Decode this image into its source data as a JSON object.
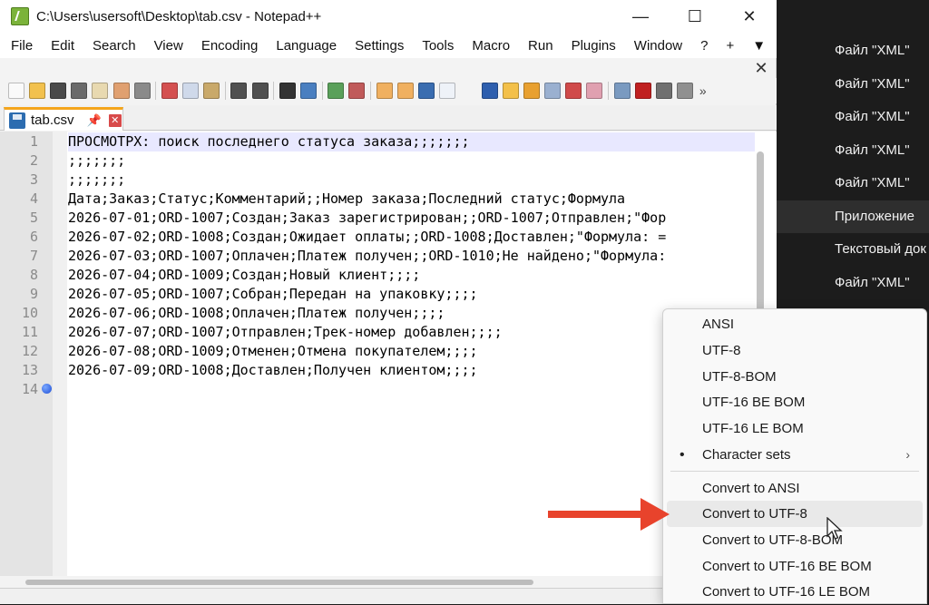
{
  "window": {
    "title": "C:\\Users\\usersoft\\Desktop\\tab.csv - Notepad++",
    "controls": [
      "—",
      "☐",
      "✕"
    ]
  },
  "menu": [
    "File",
    "Edit",
    "Search",
    "View",
    "Encoding",
    "Language",
    "Settings",
    "Tools",
    "Macro",
    "Run",
    "Plugins",
    "Window",
    "?",
    "+",
    "▼"
  ],
  "menu_close": "✕",
  "toolbar_more": "»",
  "tab": {
    "label": "tab.csv",
    "pin": "📌",
    "close": "✕"
  },
  "editor": {
    "lines": [
      "ПРОСМОТРХ: поиск последнего статуса заказа;;;;;;;",
      ";;;;;;;",
      ";;;;;;;",
      "Дата;Заказ;Статус;Комментарий;;Номер заказа;Последний статус;Формула",
      "2026-07-01;ORD-1007;Создан;Заказ зарегистрирован;;ORD-1007;Отправлен;\"Фор",
      "2026-07-02;ORD-1008;Создан;Ожидает оплаты;;ORD-1008;Доставлен;\"Формула: =",
      "2026-07-03;ORD-1007;Оплачен;Платеж получен;;ORD-1010;Не найдено;\"Формула:",
      "2026-07-04;ORD-1009;Создан;Новый клиент;;;;",
      "2026-07-05;ORD-1007;Собран;Передан на упаковку;;;;",
      "2026-07-06;ORD-1008;Оплачен;Платеж получен;;;;",
      "2026-07-07;ORD-1007;Отправлен;Трек-номер добавлен;;;;",
      "2026-07-08;ORD-1009;Отменен;Отмена покупателем;;;;",
      "2026-07-09;ORD-1008;Доставлен;Получен клиентом;;;;",
      ""
    ],
    "line_numbers": [
      "1",
      "2",
      "3",
      "4",
      "5",
      "6",
      "7",
      "8",
      "9",
      "10",
      "11",
      "12",
      "13",
      "14"
    ]
  },
  "encoding_menu": {
    "items": [
      {
        "label": "ANSI"
      },
      {
        "label": "UTF-8"
      },
      {
        "label": "UTF-8-BOM"
      },
      {
        "label": "UTF-16 BE BOM"
      },
      {
        "label": "UTF-16 LE BOM"
      },
      {
        "label": "Character sets",
        "bullet": "•",
        "submenu": "›"
      },
      {
        "label": "Convert to ANSI"
      },
      {
        "label": "Convert to UTF-8",
        "hover": true
      },
      {
        "label": "Convert to UTF-8-BOM"
      },
      {
        "label": "Convert to UTF-16 BE BOM"
      },
      {
        "label": "Convert to UTF-16 LE BOM"
      }
    ]
  },
  "background_list": [
    "Файл \"XML\"",
    "Файл \"XML\"",
    "Файл \"XML\"",
    "Файл \"XML\"",
    "Файл \"XML\"",
    "Приложение",
    "Текстовый док",
    "Файл \"XML\""
  ],
  "colors": {
    "arrow": "#e8432c",
    "tab_accent": "#f4a51c",
    "current_line": "#e8e8ff"
  }
}
